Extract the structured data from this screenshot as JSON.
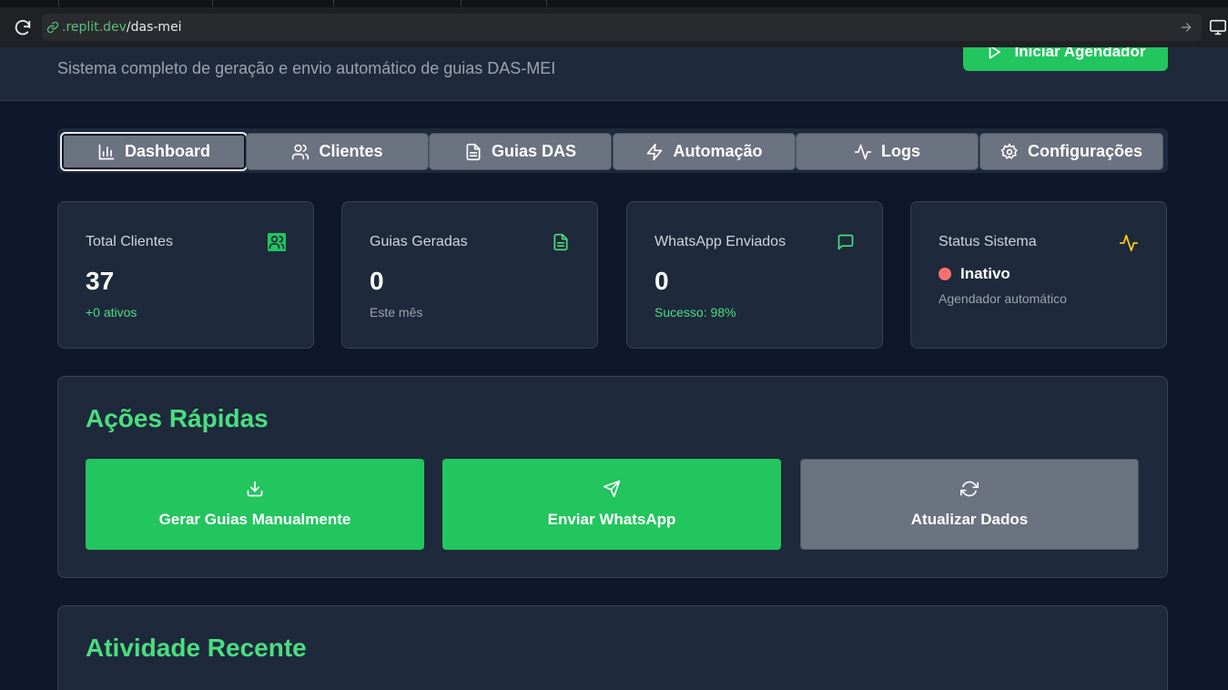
{
  "browser": {
    "url_domain": ".replit.dev",
    "url_path": "/das-mei"
  },
  "header": {
    "subtitle": "Sistema completo de geração e envio automático de guias DAS-MEI",
    "start_button": "Iniciar Agendador"
  },
  "tabs": [
    {
      "label": "Dashboard",
      "icon": "bar-chart-icon",
      "active": true
    },
    {
      "label": "Clientes",
      "icon": "users-icon"
    },
    {
      "label": "Guias DAS",
      "icon": "file-text-icon"
    },
    {
      "label": "Automação",
      "icon": "zap-icon"
    },
    {
      "label": "Logs",
      "icon": "activity-icon"
    },
    {
      "label": "Configurações",
      "icon": "settings-icon"
    }
  ],
  "stats": {
    "clients": {
      "title": "Total Clientes",
      "value": "37",
      "sub": "+0 ativos",
      "icon": "users-icon"
    },
    "guides": {
      "title": "Guias Geradas",
      "value": "0",
      "sub": "Este mês",
      "icon": "file-text-icon"
    },
    "whatsapp": {
      "title": "WhatsApp Enviados",
      "value": "0",
      "sub": "Sucesso: 98%",
      "icon": "message-square-icon"
    },
    "status": {
      "title": "Status Sistema",
      "value": "Inativo",
      "sub": "Agendador automático",
      "icon": "activity-icon"
    }
  },
  "quick_actions": {
    "title": "Ações Rápidas",
    "buttons": [
      {
        "label": "Gerar Guias Manualmente",
        "icon": "download-icon"
      },
      {
        "label": "Enviar WhatsApp",
        "icon": "send-icon"
      },
      {
        "label": "Atualizar Dados",
        "icon": "refresh-icon"
      }
    ]
  },
  "recent_activity": {
    "title": "Atividade Recente"
  },
  "colors": {
    "background": "#0f172a",
    "card": "#1e293b",
    "accent_green": "#22c55e",
    "text_green": "#4ade80",
    "tab_gray": "#6b7280",
    "status_red": "#f87171",
    "pulse_yellow": "#facc15"
  }
}
